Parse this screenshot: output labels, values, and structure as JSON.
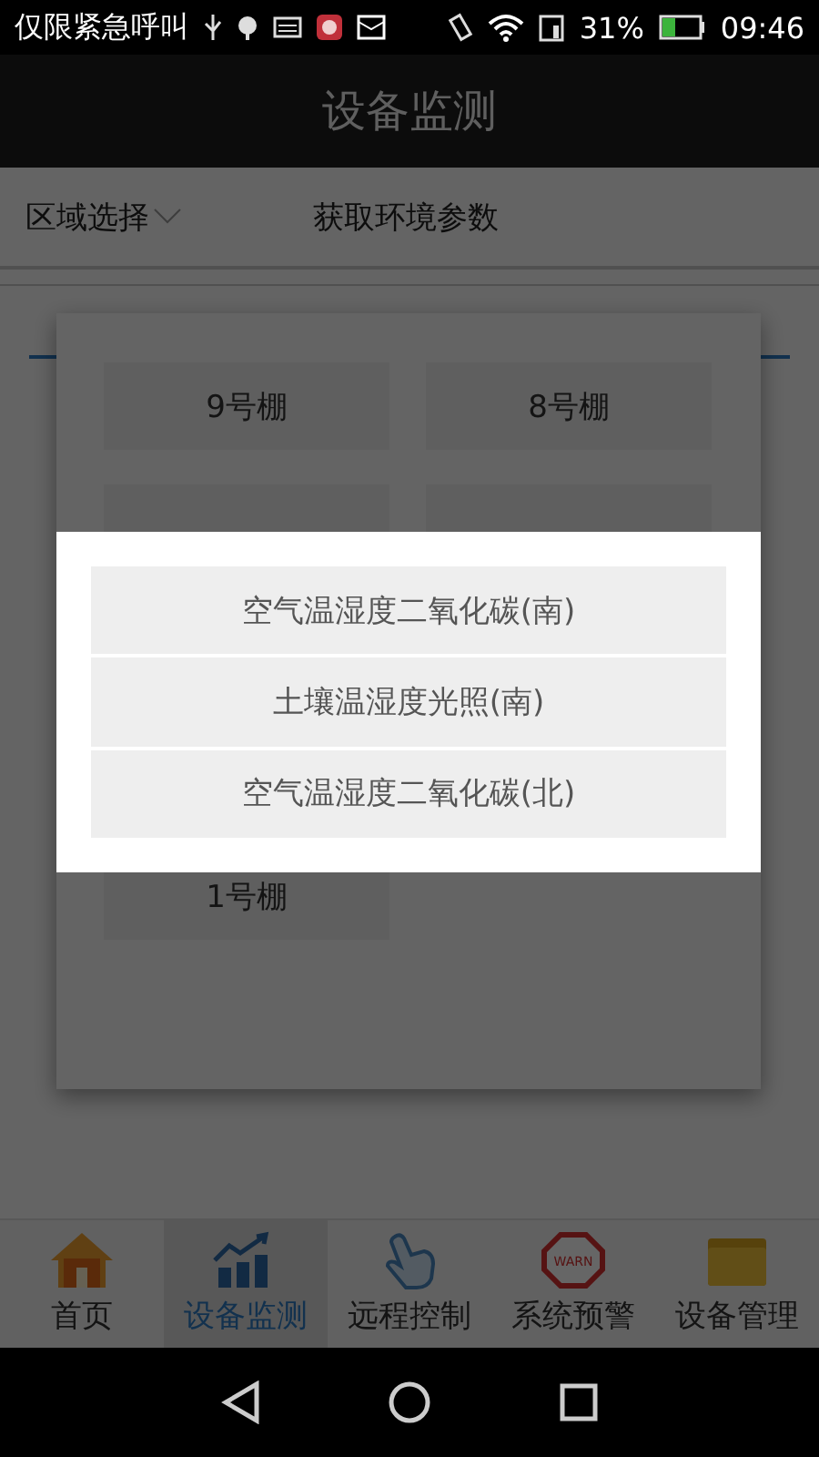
{
  "status_bar": {
    "carrier": "仅限紧急呼叫",
    "battery": "31%",
    "time": "09:46"
  },
  "title": "设备监测",
  "toolbar": {
    "region_select": "区域选择",
    "fetch_button": "获取环境参数"
  },
  "greenhouse_picker": {
    "rows": [
      [
        "9号棚",
        "8号棚"
      ]
    ],
    "last_row": [
      "1号棚"
    ]
  },
  "sensor_menu": {
    "items": [
      "空气温湿度二氧化碳(南)",
      "土壤温湿度光照(南)",
      "空气温湿度二氧化碳(北)"
    ]
  },
  "bottom_nav": [
    {
      "label": "首页",
      "kind": "home",
      "selected": false
    },
    {
      "label": "设备监测",
      "kind": "chart",
      "selected": true
    },
    {
      "label": "远程控制",
      "kind": "hand",
      "selected": false
    },
    {
      "label": "系统预警",
      "kind": "warn",
      "selected": false,
      "icon_text": "WARN"
    },
    {
      "label": "设备管理",
      "kind": "folder",
      "selected": false
    }
  ]
}
